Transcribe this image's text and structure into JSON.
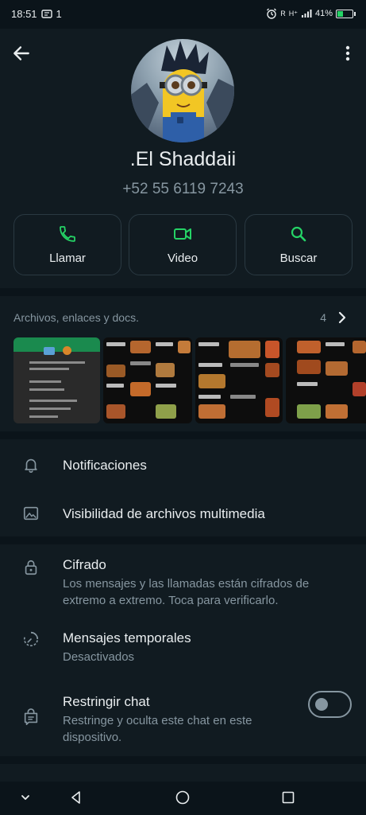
{
  "status": {
    "time": "18:51",
    "notif_count": "1",
    "network": "H⁺",
    "roaming": "R",
    "battery": "41%",
    "battery_level": 0.41
  },
  "contact": {
    "name": ".El Shaddaii",
    "phone": "+52 55 6119 7243"
  },
  "actions": [
    {
      "label": "Llamar",
      "icon": "phone-icon"
    },
    {
      "label": "Video",
      "icon": "video-icon"
    },
    {
      "label": "Buscar",
      "icon": "search-icon"
    }
  ],
  "media": {
    "title": "Archivos, enlaces y docs.",
    "count": "4"
  },
  "settings": {
    "notifications": "Notificaciones",
    "media_visibility": "Visibilidad de archivos multimedia",
    "encryption_title": "Cifrado",
    "encryption_sub": "Los mensajes y las llamadas están cifrados de extremo a extremo. Toca para verificarlo.",
    "temp_title": "Mensajes temporales",
    "temp_sub": "Desactivados",
    "restrict_title": "Restringir chat",
    "restrict_sub": "Restringe y oculta este chat en este dispositivo.",
    "restrict_enabled": false
  },
  "colors": {
    "accent": "#25d366",
    "background": "#0b141a",
    "panel": "#111b21",
    "secondary_text": "#8696a0"
  }
}
